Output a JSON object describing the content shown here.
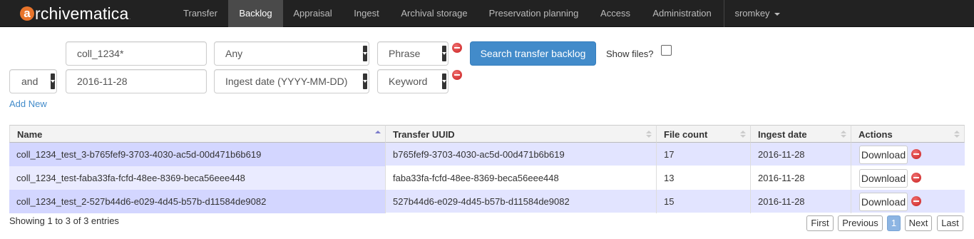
{
  "navbar": {
    "brand_initial": "a",
    "brand_rest": "rchivematica",
    "brand_mark": ".",
    "tabs": [
      {
        "label": "Transfer"
      },
      {
        "label": "Backlog"
      },
      {
        "label": "Appraisal"
      },
      {
        "label": "Ingest"
      },
      {
        "label": "Archival storage"
      },
      {
        "label": "Preservation planning"
      },
      {
        "label": "Access"
      },
      {
        "label": "Administration"
      }
    ],
    "user": "sromkey",
    "active_tab": "Backlog"
  },
  "search": {
    "rows": [
      {
        "boolean": "",
        "query": "coll_1234*",
        "field": "Any",
        "type": "Phrase"
      },
      {
        "boolean": "and",
        "query": "2016-11-28",
        "field": "Ingest date (YYYY-MM-DD)",
        "type": "Keyword"
      }
    ],
    "submit_label": "Search transfer backlog",
    "show_files_label": "Show files?",
    "show_files_checked": false,
    "add_new_label": "Add New"
  },
  "table": {
    "columns": [
      "Name",
      "Transfer UUID",
      "File count",
      "Ingest date",
      "Actions"
    ],
    "sorted_column": "Name",
    "rows": [
      {
        "name": "coll_1234_test_3-b765fef9-3703-4030-ac5d-00d471b6b619",
        "uuid": "b765fef9-3703-4030-ac5d-00d471b6b619",
        "file_count": "17",
        "ingest_date": "2016-11-28",
        "action": "Download"
      },
      {
        "name": "coll_1234_test-faba33fa-fcfd-48ee-8369-beca56eee448",
        "uuid": "faba33fa-fcfd-48ee-8369-beca56eee448",
        "file_count": "13",
        "ingest_date": "2016-11-28",
        "action": "Download"
      },
      {
        "name": "coll_1234_test_2-527b44d6-e029-4d45-b57b-d11584de9082",
        "uuid": "527b44d6-e029-4d45-b57b-d11584de9082",
        "file_count": "15",
        "ingest_date": "2016-11-28",
        "action": "Download"
      }
    ]
  },
  "pagination": {
    "info": "Showing 1 to 3 of 3 entries",
    "first": "First",
    "previous": "Previous",
    "current": "1",
    "next": "Next",
    "last": "Last"
  },
  "colors": {
    "navbar_bg": "#222222",
    "active_tab_bg": "#4a4a4a",
    "primary": "#428bca",
    "row_highlight": "#e2e4ff",
    "remove": "#c81e1e",
    "brand_accent": "#e8742b"
  }
}
